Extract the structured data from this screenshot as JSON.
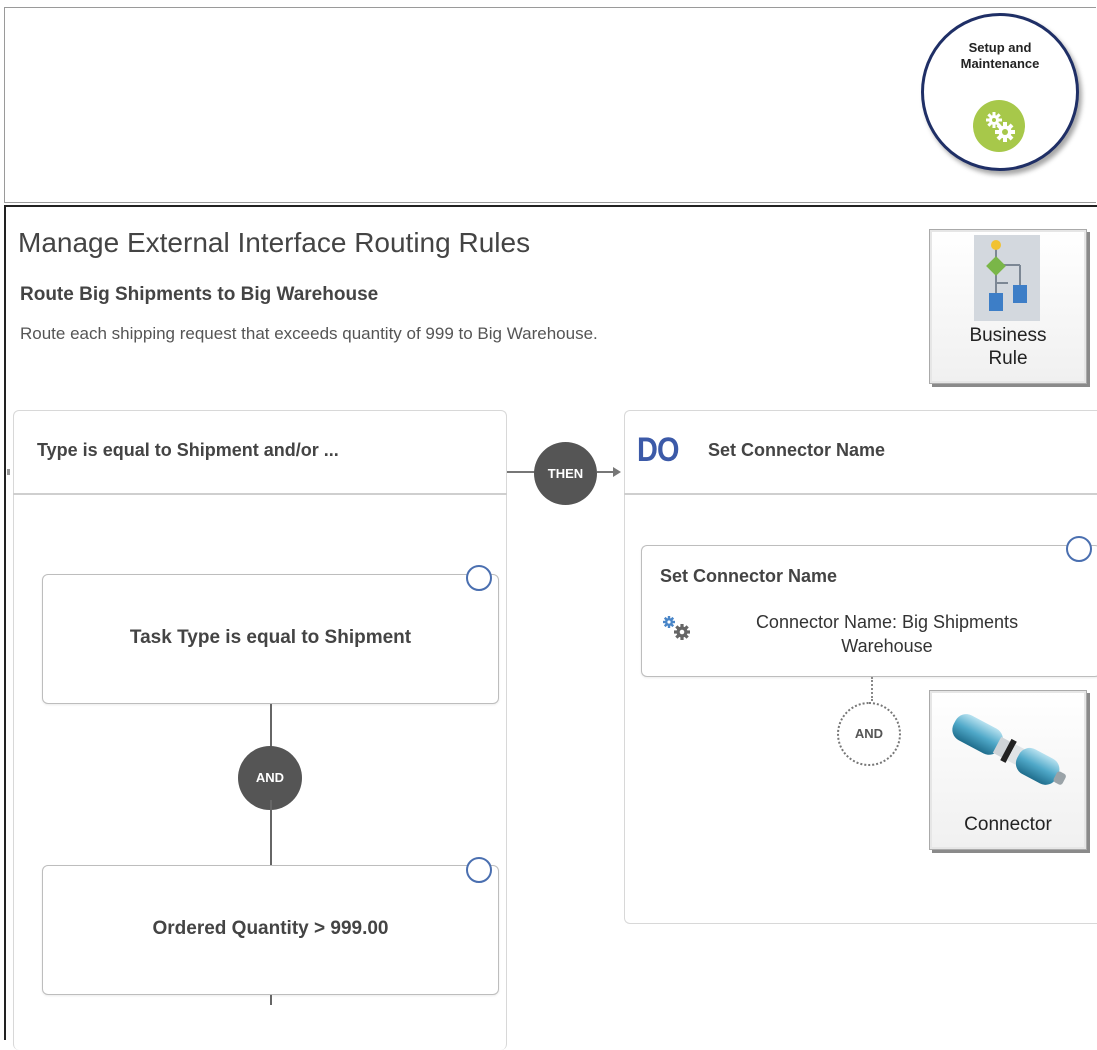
{
  "setup_badge": {
    "line1": "Setup and",
    "line2": "Maintenance",
    "icon": "gears-icon",
    "icon_color": "#a7c84a"
  },
  "page": {
    "title": "Manage External Interface Routing Rules",
    "rule_name": "Route Big Shipments to Big Warehouse",
    "rule_description": "Route each shipping request that exceeds quantity of 999 to Big Warehouse."
  },
  "business_rule_button": {
    "line1": "Business",
    "line2": "Rule",
    "icon": "business-rule-flow-icon"
  },
  "if_panel": {
    "title": "Type is equal to Shipment and/or ...",
    "conditions": [
      {
        "text": "Task Type is equal to Shipment"
      },
      {
        "text": "Ordered Quantity > 999.00"
      }
    ],
    "and_label": "AND"
  },
  "then_label": "THEN",
  "do_panel": {
    "keyword": "DO",
    "title": "Set Connector Name",
    "action": {
      "title": "Set Connector Name",
      "value_line1": "Connector Name: Big Shipments",
      "value_line2": "Warehouse",
      "icon": "gears-icon"
    },
    "and_label": "AND"
  },
  "connector_button": {
    "label": "Connector",
    "icon": "connector-pipe-icon"
  },
  "colors": {
    "do_keyword": "#3c5aa8",
    "ring": "#4a6fb0",
    "pill": "#555555",
    "badge_border": "#1f2f66"
  }
}
